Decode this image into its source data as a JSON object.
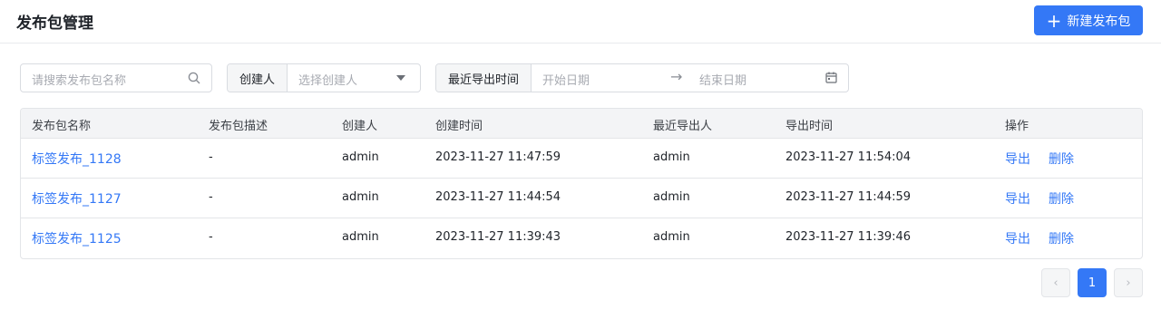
{
  "header": {
    "title": "发布包管理",
    "new_button_label": "新建发布包"
  },
  "filters": {
    "search_placeholder": "请搜索发布包名称",
    "creator_label": "创建人",
    "creator_placeholder": "选择创建人",
    "export_time_label": "最近导出时间",
    "start_placeholder": "开始日期",
    "range_separator": "→",
    "end_placeholder": "结束日期"
  },
  "table": {
    "columns": [
      "发布包名称",
      "发布包描述",
      "创建人",
      "创建时间",
      "最近导出人",
      "导出时间",
      "操作"
    ],
    "rows": [
      {
        "name": "标签发布_1128",
        "desc": "-",
        "creator": "admin",
        "created_at": "2023-11-27 11:47:59",
        "exporter": "admin",
        "exported_at": "2023-11-27 11:54:04",
        "export": "导出",
        "delete": "删除"
      },
      {
        "name": "标签发布_1127",
        "desc": "-",
        "creator": "admin",
        "created_at": "2023-11-27 11:44:54",
        "exporter": "admin",
        "exported_at": "2023-11-27 11:44:59",
        "export": "导出",
        "delete": "删除"
      },
      {
        "name": "标签发布_1125",
        "desc": "-",
        "creator": "admin",
        "created_at": "2023-11-27 11:39:43",
        "exporter": "admin",
        "exported_at": "2023-11-27 11:39:46",
        "export": "导出",
        "delete": "删除"
      }
    ]
  },
  "pagination": {
    "prev": "‹",
    "current_page": "1",
    "next": "›"
  },
  "colors": {
    "accent": "#3478f6",
    "header_bg": "#f3f4f6"
  }
}
